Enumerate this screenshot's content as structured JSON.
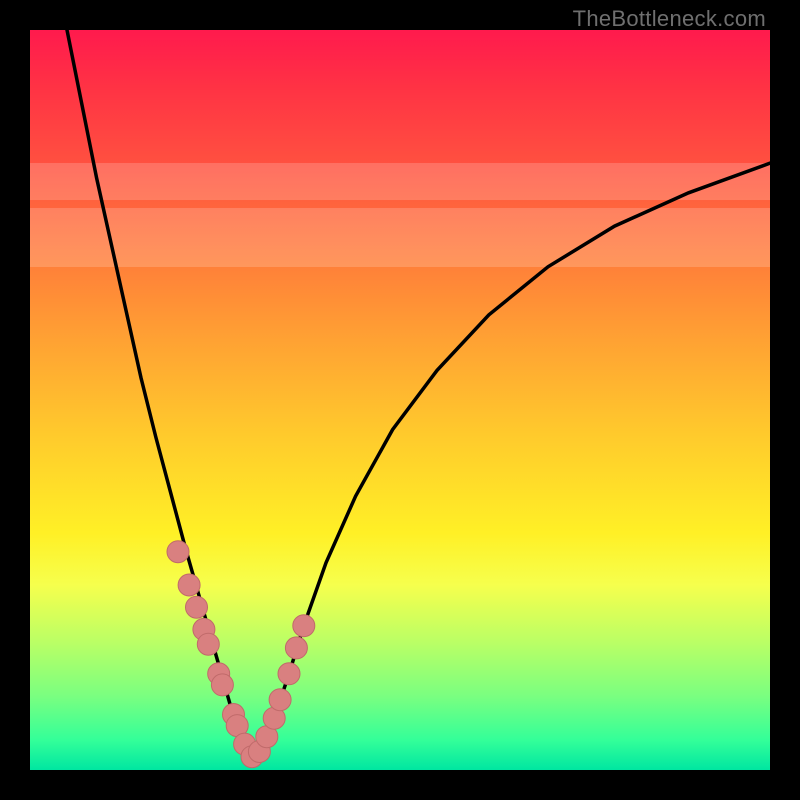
{
  "watermark": "TheBottleneck.com",
  "colors": {
    "curve_stroke": "#000000",
    "marker_fill": "#d98080",
    "marker_stroke": "#c06a6a"
  },
  "chart_data": {
    "type": "line",
    "title": "",
    "xlabel": "",
    "ylabel": "",
    "xlim": [
      0,
      100
    ],
    "ylim": [
      0,
      100
    ],
    "grid": false,
    "legend": null,
    "series": [
      {
        "name": "left-branch",
        "x": [
          5,
          7,
          9,
          11,
          13,
          15,
          17,
          19,
          21,
          23,
          24,
          25,
          26,
          27,
          28,
          29,
          30
        ],
        "y": [
          100,
          90,
          80,
          71,
          62,
          53,
          45,
          37.5,
          30,
          23,
          19.5,
          16,
          12.5,
          9,
          6,
          3.5,
          1.5
        ]
      },
      {
        "name": "right-branch",
        "x": [
          30,
          31,
          32,
          33,
          34,
          35,
          37,
          40,
          44,
          49,
          55,
          62,
          70,
          79,
          89,
          100
        ],
        "y": [
          1.5,
          2.5,
          4.5,
          7,
          10,
          13,
          19.5,
          28,
          37,
          46,
          54,
          61.5,
          68,
          73.5,
          78,
          82
        ]
      }
    ],
    "markers": {
      "name": "highlight-points",
      "x": [
        20.0,
        21.5,
        22.5,
        23.5,
        24.1,
        25.5,
        26.0,
        27.5,
        28.0,
        29.0,
        30.0,
        31.0,
        32.0,
        33.0,
        33.8,
        35.0,
        36.0,
        37.0
      ],
      "y": [
        29.5,
        25.0,
        22.0,
        19.0,
        17.0,
        13.0,
        11.5,
        7.5,
        6.0,
        3.5,
        1.8,
        2.5,
        4.5,
        7.0,
        9.5,
        13.0,
        16.5,
        19.5
      ]
    },
    "bands": [
      {
        "y0": 68,
        "y1": 76
      },
      {
        "y0": 77,
        "y1": 82
      }
    ]
  }
}
